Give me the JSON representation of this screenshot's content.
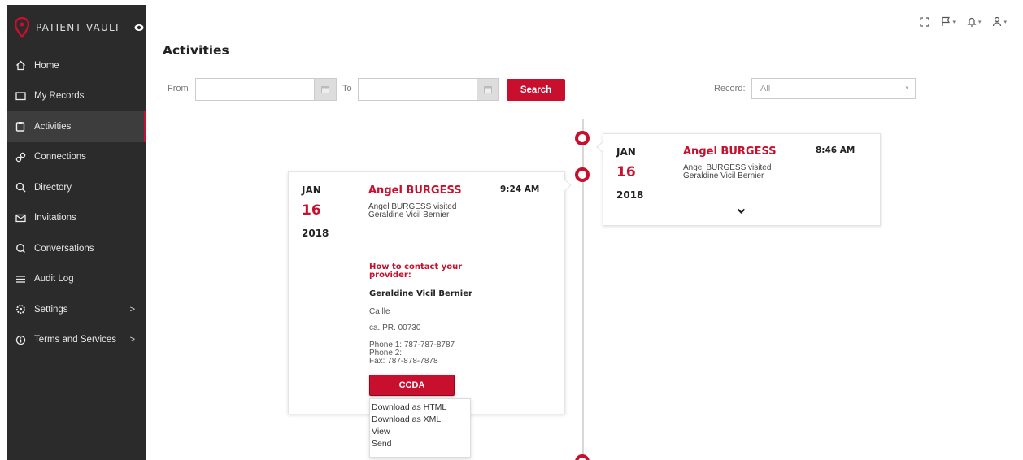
{
  "brand": {
    "name": "PATIENT VAULT"
  },
  "sidebar": {
    "items": [
      {
        "label": "Home",
        "icon": "home-icon"
      },
      {
        "label": "My Records",
        "icon": "folder-icon"
      },
      {
        "label": "Activities",
        "icon": "clipboard-icon",
        "active": true
      },
      {
        "label": "Connections",
        "icon": "link-icon"
      },
      {
        "label": "Directory",
        "icon": "search-icon"
      },
      {
        "label": "Invitations",
        "icon": "envelope-icon"
      },
      {
        "label": "Conversations",
        "icon": "chat-icon"
      },
      {
        "label": "Audit Log",
        "icon": "list-icon"
      },
      {
        "label": "Settings",
        "icon": "gear-icon",
        "chevron": ">"
      },
      {
        "label": "Terms and Services",
        "icon": "info-icon",
        "chevron": ">"
      }
    ]
  },
  "page": {
    "title": "Activities"
  },
  "filters": {
    "from_label": "From",
    "to_label": "To",
    "from_value": "",
    "to_value": "",
    "search_label": "Search",
    "record_label": "Record:",
    "record_value": "All"
  },
  "cards": [
    {
      "month": "JAN",
      "day": "16",
      "year": "2018",
      "name": "Angel BURGESS",
      "time": "8:46 AM",
      "desc": "Angel BURGESS visited Geraldine Vicil Bernier"
    },
    {
      "month": "JAN",
      "day": "16",
      "year": "2018",
      "name": "Angel BURGESS",
      "time": "9:24 AM",
      "desc": "Angel BURGESS visited Geraldine Vicil Bernier",
      "contact": {
        "heading": "How to contact your provider:",
        "provider": "Geraldine Vicil Bernier",
        "address1": "Ca lle",
        "address2": "ca. PR. 00730",
        "phone1": "Phone 1: 787-787-8787",
        "phone2": "Phone 2:",
        "fax": "Fax: 787-878-7878"
      },
      "ccda_label": "CCDA",
      "ccda_menu": [
        "Download as HTML",
        "Download as XML",
        "View",
        "Send"
      ]
    }
  ],
  "colors": {
    "accent": "#c8102e",
    "sidebar": "#2b2b2b"
  }
}
